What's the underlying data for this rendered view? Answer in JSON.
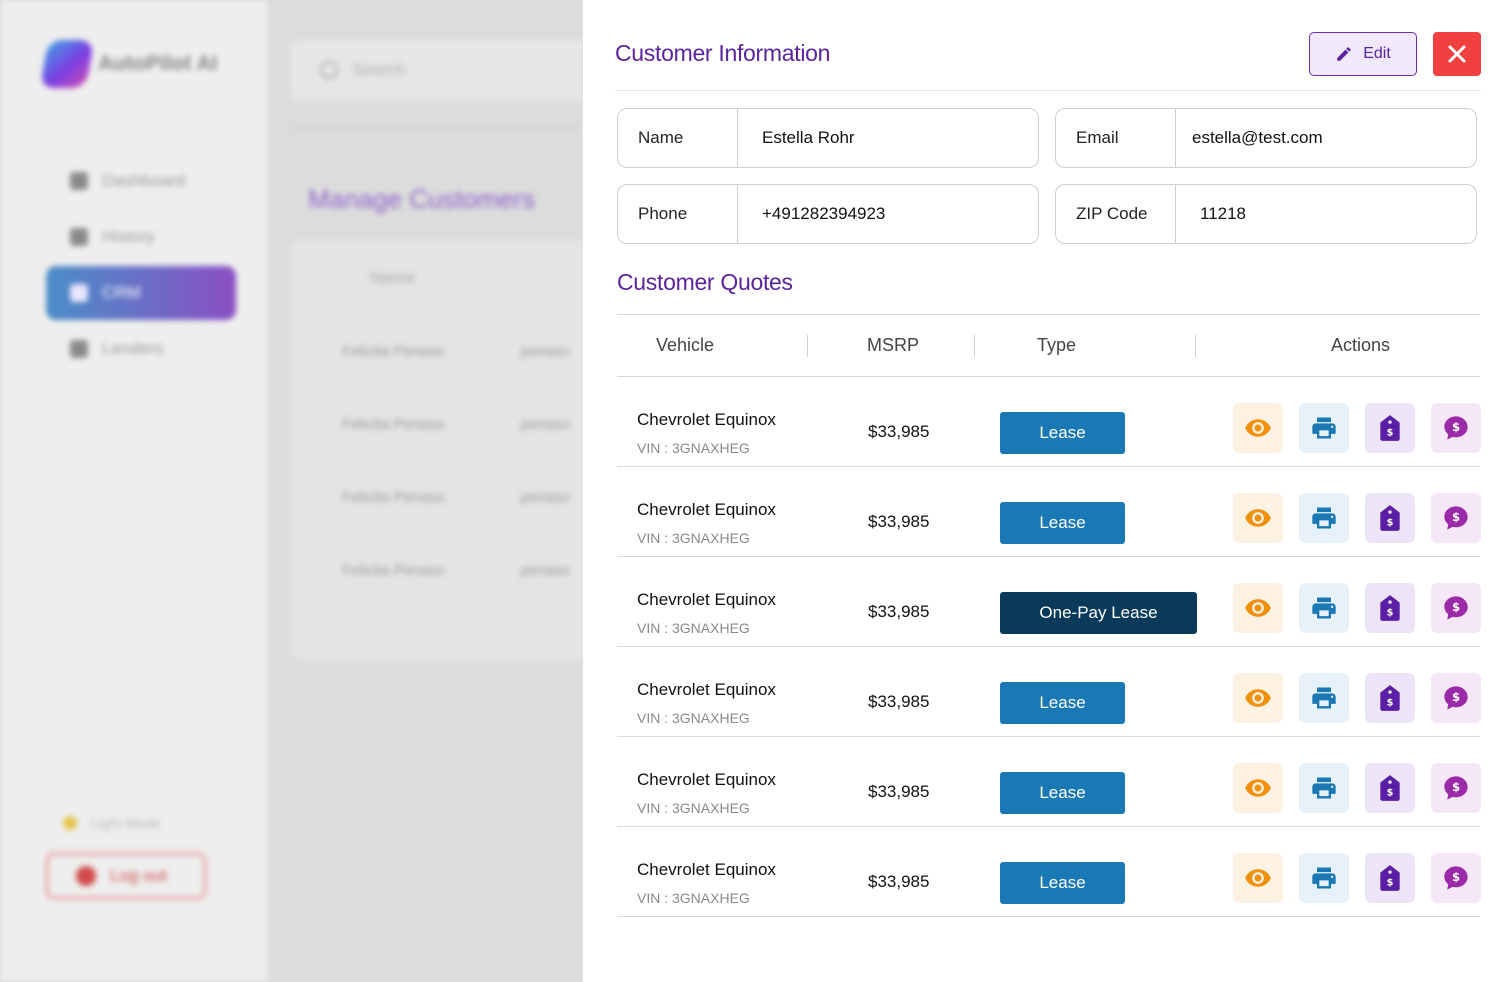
{
  "background": {
    "brand": "AutoPilot AI",
    "nav": [
      {
        "label": "Dashboard"
      },
      {
        "label": "History"
      },
      {
        "label": "CRM"
      },
      {
        "label": "Lenders"
      }
    ],
    "light_mode": "Light Mode",
    "logout": "Log out",
    "search_placeholder": "Search",
    "page_title": "Manage Customers",
    "table_header": "Name",
    "rows": [
      {
        "name": "Felicita Penaso",
        "email": "penaso"
      },
      {
        "name": "Felicita Penaso",
        "email": "penaso"
      },
      {
        "name": "Felicita Penaso",
        "email": "penaso"
      },
      {
        "name": "Felicita Penaso",
        "email": "penaso"
      }
    ]
  },
  "modal": {
    "title": "Customer Information",
    "edit_label": "Edit",
    "fields": {
      "name": {
        "label": "Name",
        "value": "Estella Rohr"
      },
      "email": {
        "label": "Email",
        "value": "estella@test.com"
      },
      "phone": {
        "label": "Phone",
        "value": "+491282394923"
      },
      "zip": {
        "label": "ZIP Code",
        "value": "11218"
      }
    },
    "quotes_title": "Customer Quotes",
    "columns": {
      "vehicle": "Vehicle",
      "msrp": "MSRP",
      "type": "Type",
      "actions": "Actions"
    },
    "quotes": [
      {
        "vehicle": "Chevrolet Equinox",
        "vin": "VIN : 3GNAXHEG",
        "msrp": "$33,985",
        "type": "Lease"
      },
      {
        "vehicle": "Chevrolet Equinox",
        "vin": "VIN : 3GNAXHEG",
        "msrp": "$33,985",
        "type": "Lease"
      },
      {
        "vehicle": "Chevrolet Equinox",
        "vin": "VIN : 3GNAXHEG",
        "msrp": "$33,985",
        "type": "One-Pay Lease"
      },
      {
        "vehicle": "Chevrolet Equinox",
        "vin": "VIN : 3GNAXHEG",
        "msrp": "$33,985",
        "type": "Lease"
      },
      {
        "vehicle": "Chevrolet Equinox",
        "vin": "VIN : 3GNAXHEG",
        "msrp": "$33,985",
        "type": "Lease"
      },
      {
        "vehicle": "Chevrolet Equinox",
        "vin": "VIN : 3GNAXHEG",
        "msrp": "$33,985",
        "type": "Lease"
      }
    ],
    "action_icons": [
      "eye-icon",
      "printer-icon",
      "price-tag-icon",
      "dollar-chat-icon"
    ]
  },
  "colors": {
    "accent_purple": "#5a23a0",
    "lease_blue": "#1a78b4",
    "onepay_navy": "#093a5a",
    "close_red": "#f04040",
    "view_orange": "#f0900f",
    "print_blue": "#1a78b4",
    "tag_purple": "#5b1fa6",
    "chat_purple": "#9a2aa8"
  }
}
